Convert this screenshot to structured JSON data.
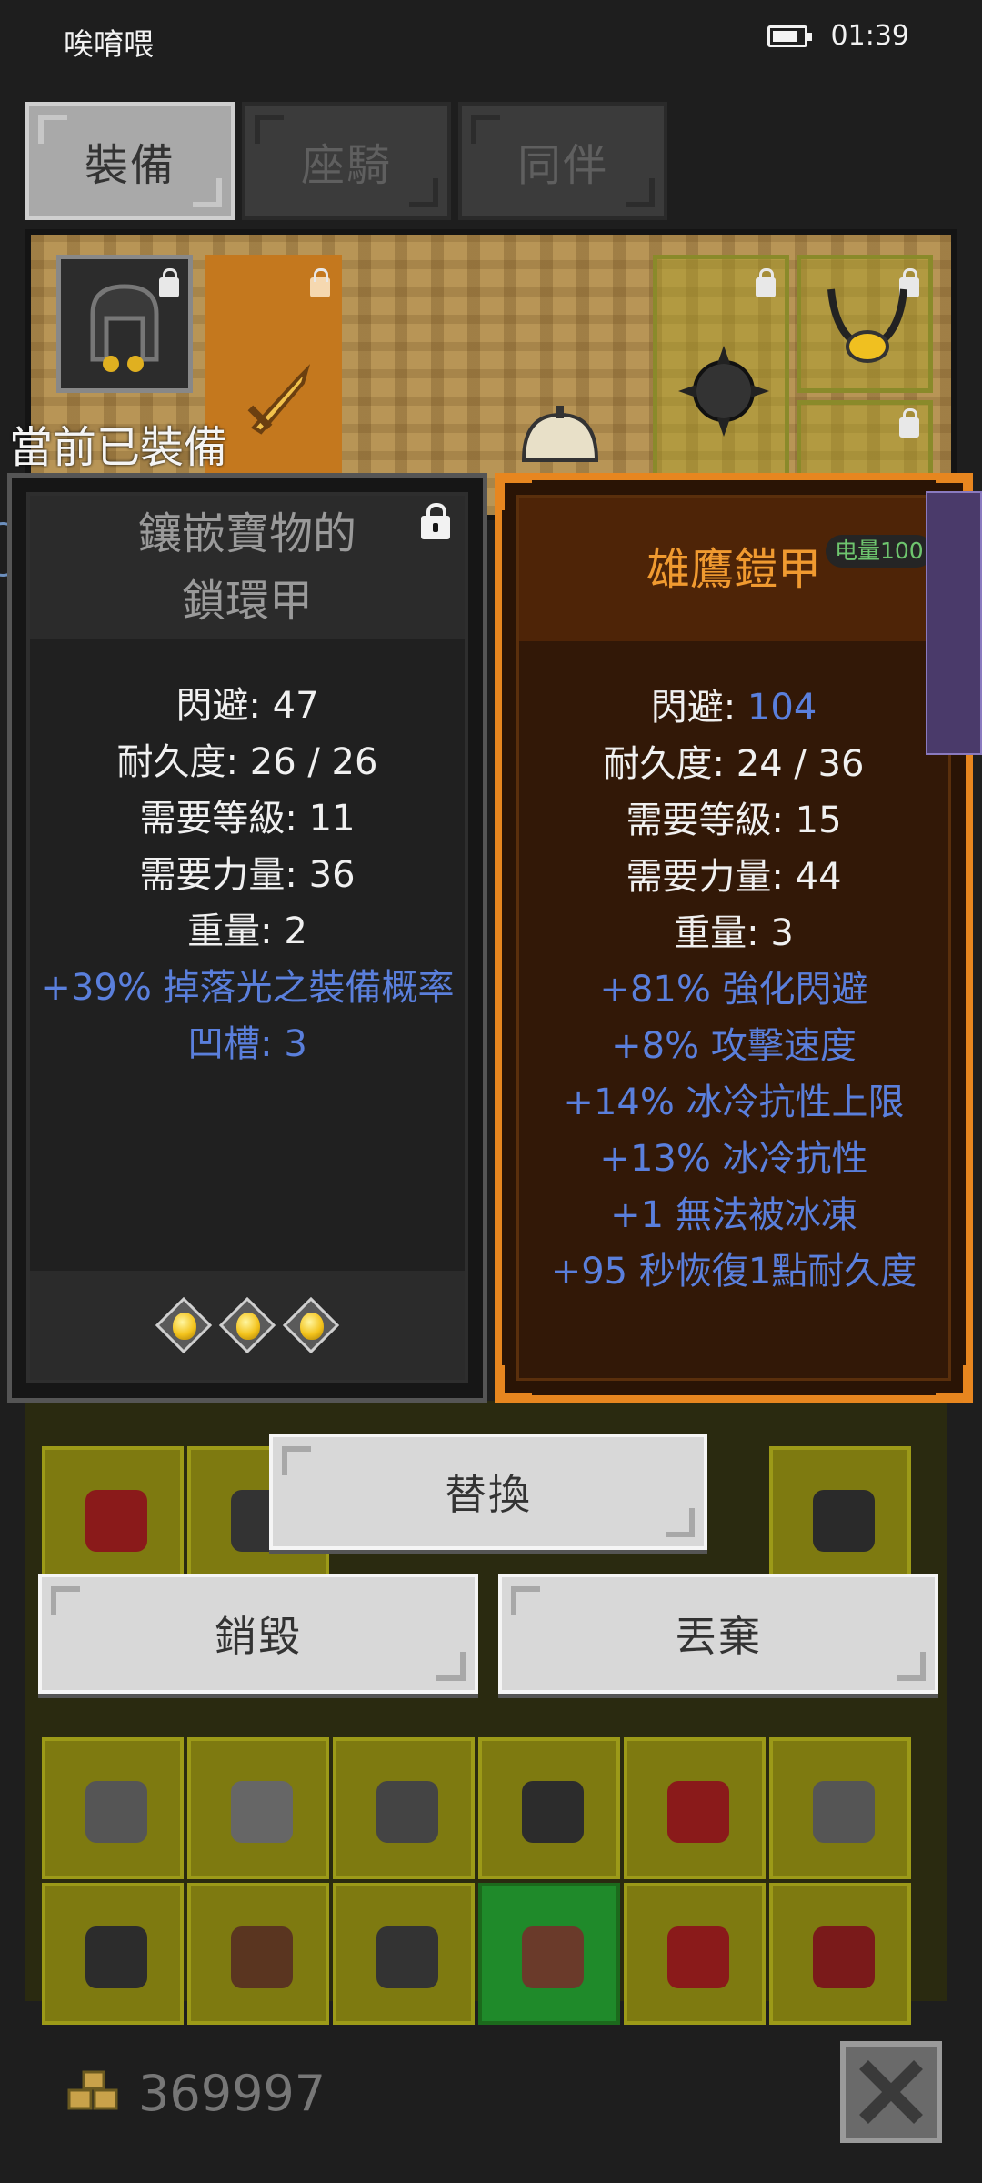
{
  "status_bar": {
    "carrier": "唉唷喂",
    "time": "01:39"
  },
  "tabs": [
    {
      "label": "裝備",
      "active": true
    },
    {
      "label": "座騎",
      "active": false
    },
    {
      "label": "同伴",
      "active": false
    }
  ],
  "equipped_label": "當前已裝備",
  "current_item": {
    "name_line1": "鑲嵌寶物的",
    "name_line2": "鎖環甲",
    "locked": true,
    "stats": [
      {
        "label": "閃避: ",
        "value": "47"
      },
      {
        "label": "耐久度: ",
        "value": "26 / 26"
      },
      {
        "label": "需要等級: ",
        "value": "11"
      },
      {
        "label": "需要力量: ",
        "value": "36"
      },
      {
        "label": "重量: ",
        "value": "2"
      }
    ],
    "affixes": [
      "+39% 掉落光之裝備概率",
      "凹槽: 3"
    ],
    "socketed_gems": 3
  },
  "compare_item": {
    "name": "雄鷹鎧甲",
    "stats": [
      {
        "label": "閃避: ",
        "value": "104",
        "highlight": true
      },
      {
        "label": "耐久度: ",
        "value": "24 / 36"
      },
      {
        "label": "需要等級: ",
        "value": "15"
      },
      {
        "label": "需要力量: ",
        "value": "44"
      },
      {
        "label": "重量: ",
        "value": "3"
      }
    ],
    "affixes": [
      "+81% 強化閃避",
      "+8% 攻擊速度",
      "+14% 冰冷抗性上限",
      "+13% 冰冷抗性",
      "+1 無法被冰凍",
      "+95 秒恢復1點耐久度"
    ]
  },
  "power_badge": "电量100",
  "actions": {
    "replace": "替換",
    "destroy": "銷毀",
    "discard": "丟棄"
  },
  "gold": {
    "amount": "369997"
  },
  "colors": {
    "affix_blue": "#5a7fdc",
    "compare_title": "#f09a30",
    "compare_border": "#e7861f",
    "inventory_slot": "#7e7a10"
  },
  "icons": [
    "battery-icon",
    "lock-icon",
    "gem-icon",
    "gold-coins-icon",
    "close-icon"
  ]
}
